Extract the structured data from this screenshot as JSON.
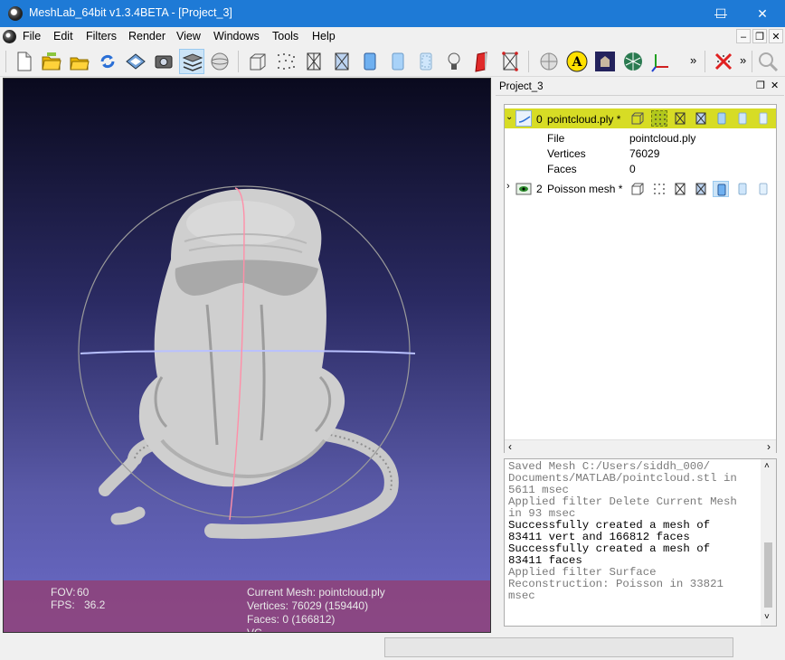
{
  "window": {
    "title": "MeshLab_64bit v1.3.4BETA - [Project_3]",
    "controls": {
      "minimize": "—",
      "maximize": "☐",
      "close": "✕"
    }
  },
  "menubar": {
    "items": [
      "File",
      "Edit",
      "Filters",
      "Render",
      "View",
      "Windows",
      "Tools",
      "Help"
    ],
    "mdi": {
      "minimize": "–",
      "restore": "❐",
      "close": "✕"
    }
  },
  "toolbar": {
    "overflow1": "»",
    "overflow2": "»",
    "icons": [
      "new-project-icon",
      "open-project-icon",
      "import-mesh-icon",
      "reload-icon",
      "export-mesh-icon",
      "snapshot-icon",
      "layers-icon",
      "globe-icon",
      "bounding-box-icon",
      "points-icon",
      "wireframe-icon",
      "hidden-lines-icon",
      "flat-lines-icon",
      "flat-icon",
      "smooth-icon",
      "texture-icon",
      "light-icon",
      "fancy-lighting-icon",
      "backface-culling-icon",
      "trackball-icon",
      "annotation-icon",
      "measure-icon",
      "mesh-icon",
      "axis-icon",
      "delete-icon",
      "zoom-icon"
    ]
  },
  "viewport": {
    "fov_label": "FOV:",
    "fov_value": "60",
    "fps_label": "FPS:",
    "fps_value": "36.2",
    "current_mesh": "Current Mesh: pointcloud.ply",
    "vertices": "Vertices: 76029 (159440)",
    "faces": "Faces: 0 (166812)",
    "vc": "VC"
  },
  "panel": {
    "title": "Project_3",
    "float_btn": "❐",
    "close_btn": "✕",
    "layers": [
      {
        "index": "0",
        "name": "pointcloud.ply *",
        "expanded": true,
        "selected": true
      },
      {
        "index": "2",
        "name": "Poisson mesh *",
        "expanded": false,
        "selected": false
      }
    ],
    "details": [
      {
        "key": "File",
        "value": "pointcloud.ply"
      },
      {
        "key": "Vertices",
        "value": "76029"
      },
      {
        "key": "Faces",
        "value": "0"
      }
    ],
    "hscroll_left": "‹",
    "hscroll_right": "›",
    "log_up": "˄",
    "log_down": "˅"
  },
  "log": {
    "lines": [
      {
        "text": "Saved Mesh C:/Users/siddh_000/",
        "style": "faded"
      },
      {
        "text": "Documents/MATLAB/pointcloud.stl in",
        "style": "faded"
      },
      {
        "text": "5611 msec",
        "style": "faded"
      },
      {
        "text": "Applied filter Delete Current Mesh",
        "style": "faded"
      },
      {
        "text": "in 93 msec",
        "style": "faded"
      },
      {
        "text": "Successfully created a mesh of",
        "style": "strong"
      },
      {
        "text": "83411 vert and 166812 faces",
        "style": "strong"
      },
      {
        "text": "Successfully created a mesh of",
        "style": "strong"
      },
      {
        "text": "83411 faces",
        "style": "strong"
      },
      {
        "text": "Applied filter Surface",
        "style": "faded"
      },
      {
        "text": "Reconstruction: Poisson in 33821",
        "style": "faded"
      },
      {
        "text": "msec",
        "style": "faded"
      }
    ]
  },
  "colors": {
    "titlebar": "#1e7ad6",
    "selected_row": "#d7dc25",
    "info_overlay": "#963c6e",
    "log_faded": "#7a7a7a",
    "log_strong": "#000000"
  }
}
